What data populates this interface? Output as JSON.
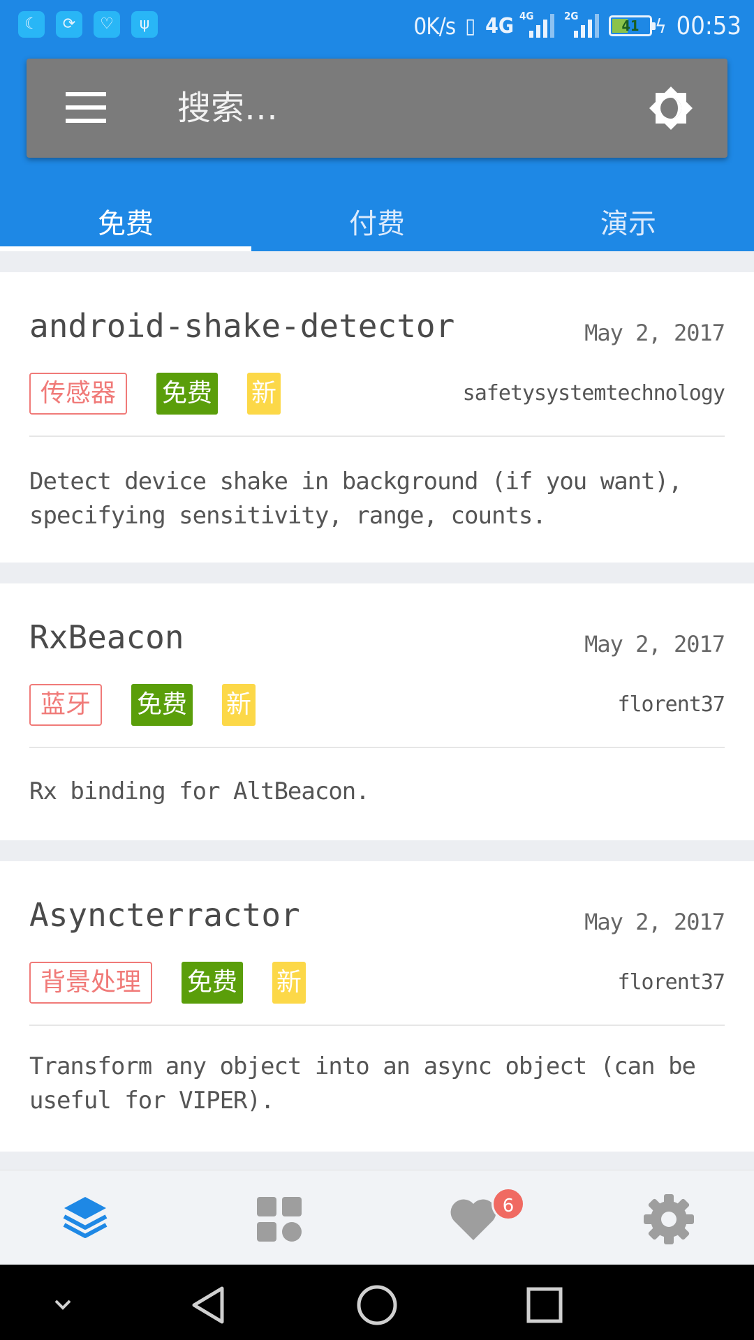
{
  "status_bar": {
    "net_speed": "0K/s",
    "network_4g": "4G",
    "network_4g_small": "4G",
    "network_2g": "2G",
    "battery_level": "41",
    "time": "00:53",
    "notification_icons": [
      "moon-app-icon",
      "sync-app-icon",
      "heart-monitor-icon",
      "usb-icon"
    ]
  },
  "search": {
    "placeholder": "搜索…"
  },
  "tabs": [
    {
      "label": "免费",
      "active": true
    },
    {
      "label": "付费",
      "active": false
    },
    {
      "label": "演示",
      "active": false
    }
  ],
  "cards": [
    {
      "title": "android-shake-detector",
      "date": "May 2, 2017",
      "category": "传感器",
      "price_tag": "免费",
      "new_tag": "新",
      "author": "safetysystemtechnology",
      "description": "Detect device shake in background (if you want), specifying sensitivity, range, counts."
    },
    {
      "title": "RxBeacon",
      "date": "May 2, 2017",
      "category": "蓝牙",
      "price_tag": "免费",
      "new_tag": "新",
      "author": "florent37",
      "description": "Rx binding for AltBeacon."
    },
    {
      "title": "Asyncterractor",
      "date": "May 2, 2017",
      "category": "背景处理",
      "price_tag": "免费",
      "new_tag": "新",
      "author": "florent37",
      "description": "Transform any object into an async object (can be useful for VIPER)."
    }
  ],
  "bottom_nav": {
    "items": [
      "layers-icon",
      "grid-icon",
      "heart-icon",
      "settings-icon"
    ],
    "favorites_badge": "6",
    "active_color": "#1e88e5",
    "inactive_color": "#9e9e9e"
  },
  "colors": {
    "primary": "#1e88e5",
    "category_tag": "#f07a78",
    "free_tag": "#5a9e0a",
    "new_tag": "#fcd848"
  }
}
